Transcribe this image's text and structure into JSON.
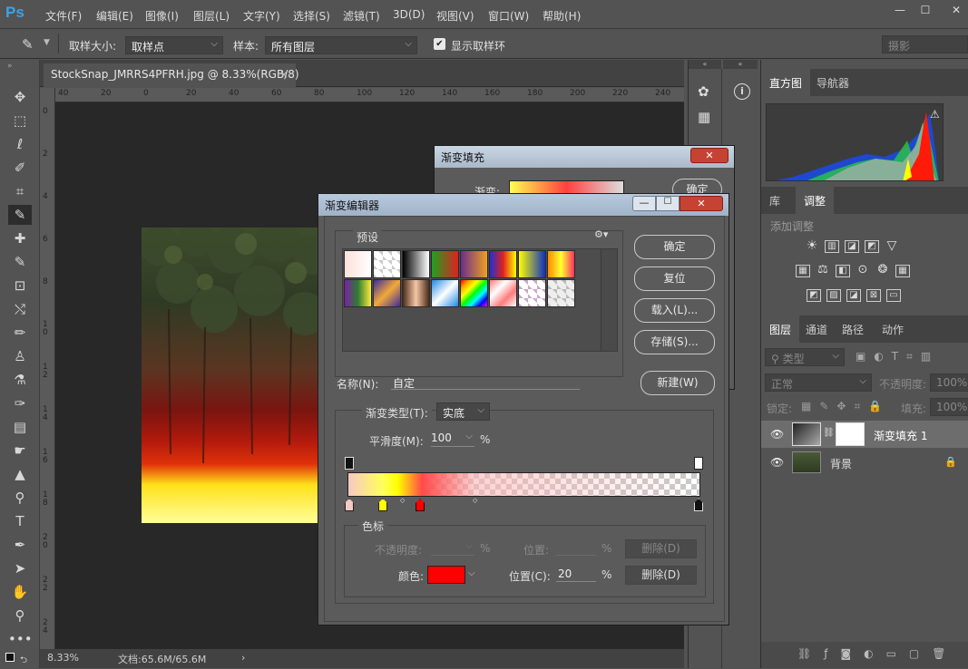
{
  "menubar": {
    "logo": "Ps",
    "items": [
      "文件(F)",
      "编辑(E)",
      "图像(I)",
      "图层(L)",
      "文字(Y)",
      "选择(S)",
      "滤镜(T)",
      "3D(D)",
      "视图(V)",
      "窗口(W)",
      "帮助(H)"
    ],
    "minimize": "—",
    "restore": "☐",
    "close": "✕"
  },
  "options": {
    "sample_size_label": "取样大小:",
    "sample_size_value": "取样点",
    "sample_label": "样本:",
    "sample_value": "所有图层",
    "show_ring_label": "显示取样环",
    "search_placeholder": "摄影"
  },
  "document": {
    "tab_title": "StockSnap_JMRRS4PFRH.jpg @ 8.33%(RGB/8)",
    "tab_close": "×",
    "zoom": "8.33%",
    "doc_info": "文档:65.6M/65.6M",
    "status_arrow": "›",
    "ruler_h": [
      "40",
      "20",
      "0",
      "20",
      "40",
      "60",
      "80",
      "100",
      "120",
      "140",
      "160",
      "180",
      "200",
      "220",
      "240"
    ],
    "ruler_v": [
      "0",
      "2",
      "4",
      "6",
      "8",
      "1 0",
      "1 2",
      "1 4",
      "1 6",
      "1 8",
      "2 0",
      "2 2",
      "2 4"
    ]
  },
  "right_panel": {
    "histogram_tab": "直方图",
    "navigator_tab": "导航器",
    "library_tab": "库",
    "adjust_tab": "调整",
    "add_adjust_label": "添加调整",
    "layers_tab": "图层",
    "channels_tab": "通道",
    "paths_tab": "路径",
    "actions_tab": "动作",
    "kind_label": "类型",
    "blend_mode": "正常",
    "opacity_label": "不透明度:",
    "opacity_value": "100%",
    "lock_label": "锁定:",
    "fill_label": "填充:",
    "fill_value": "100%",
    "layers": [
      {
        "name": "渐变填充 1"
      },
      {
        "name": "背景"
      }
    ]
  },
  "gradient_fill_dialog": {
    "title": "渐变填充",
    "gradient_label": "渐变:",
    "ok": "确定"
  },
  "gradient_editor": {
    "title": "渐变编辑器",
    "presets_label": "预设",
    "ok": "确定",
    "reset": "复位",
    "load": "载入(L)...",
    "save": "存储(S)...",
    "name_label": "名称(N):",
    "name_value": "自定",
    "new_button": "新建(W)",
    "type_label": "渐变类型(T):",
    "type_value": "实底",
    "smooth_label": "平滑度(M):",
    "smooth_value": "100",
    "smooth_unit": "%",
    "stops_group": "色标",
    "opacity_label": "不透明度:",
    "opacity_unit": "%",
    "location_label": "位置:",
    "location_unit": "%",
    "delete_label": "删除(D)",
    "color_label": "颜色:",
    "color_value": "#ff0000",
    "color_location_label": "位置(C):",
    "color_location_value": "20",
    "color_location_unit": "%"
  },
  "colors": {
    "accent_blue": "#3ba3e8",
    "stop_red": "#ff0000",
    "stop_yellow": "#ffff00",
    "stop_light": "#f7c9c3"
  }
}
